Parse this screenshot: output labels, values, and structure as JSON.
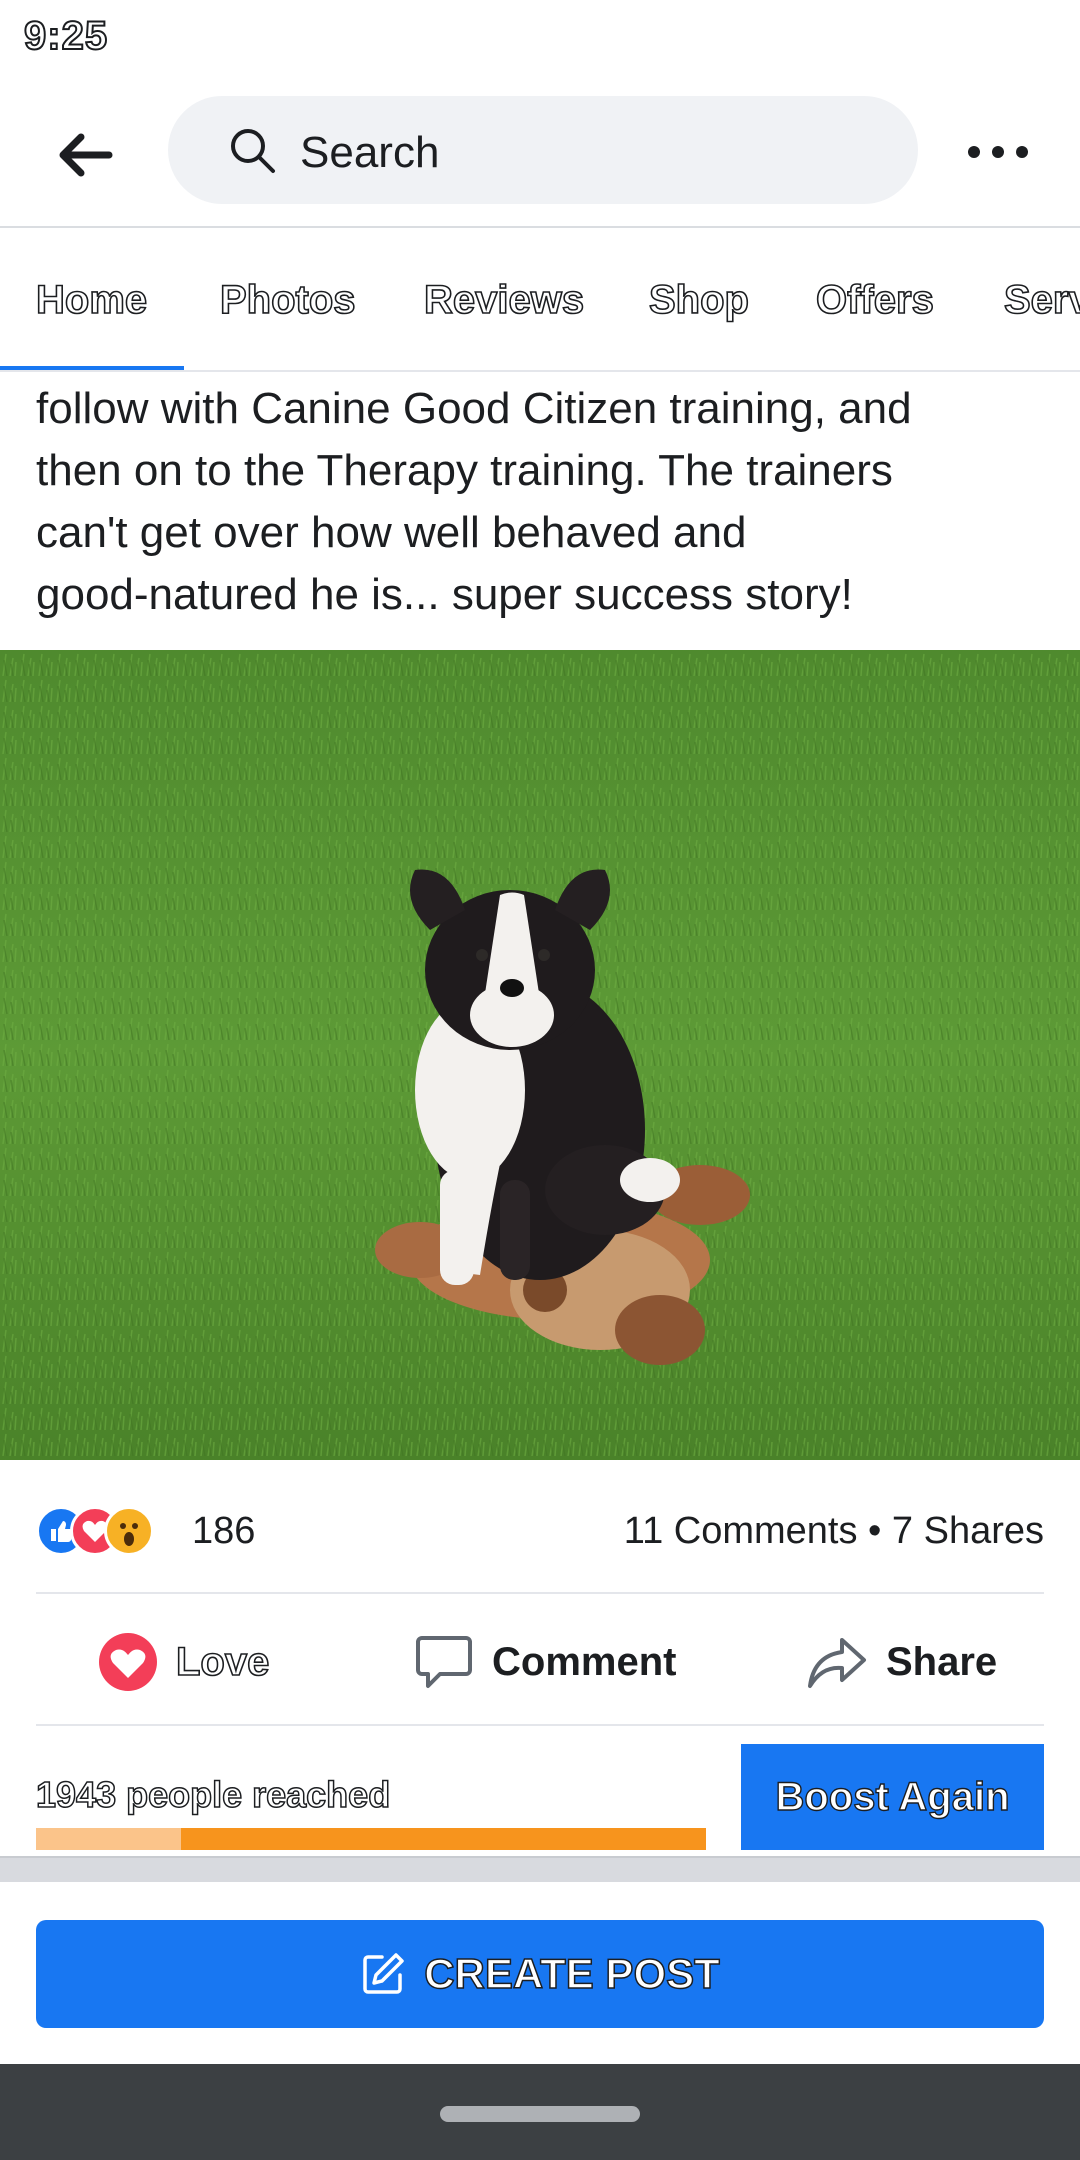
{
  "status_bar": {
    "time": "9:25"
  },
  "top_bar": {
    "search_placeholder": "Search"
  },
  "tabs": [
    "Home",
    "Photos",
    "Reviews",
    "Shop",
    "Offers",
    "Serv"
  ],
  "post": {
    "text_lines": [
      "follow with Canine Good Citizen training, and",
      "then on to the Therapy training. The trainers",
      "can't get over how well behaved and",
      "good-natured he is... super success story!"
    ],
    "photo_subject": "puppy-sitting-on-grass-with-plush-toy"
  },
  "engagement": {
    "reaction_count": "186",
    "comments": "11 Comments",
    "separator": "•",
    "shares": "7 Shares"
  },
  "actions": {
    "love": "Love",
    "comment": "Comment",
    "share": "Share"
  },
  "boost": {
    "reach_text": "1943 people reached",
    "reach_fraction": 0.217,
    "button_label": "Boost Again"
  },
  "create_post": {
    "label": "CREATE POST"
  },
  "colors": {
    "accent": "#1877f2",
    "love": "#f33e58",
    "like": "#1877f2",
    "wow": "#f7b125",
    "reach_bar": "#f7941d",
    "reach_bar_light": "#fbc48a"
  }
}
